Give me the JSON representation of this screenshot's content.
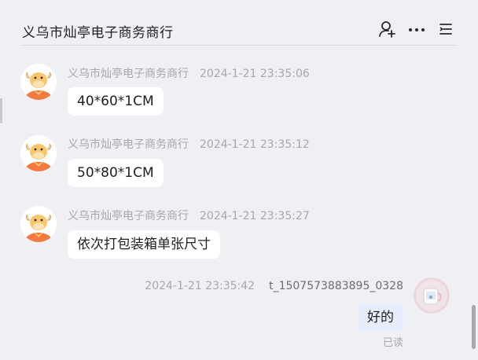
{
  "header": {
    "title": "义乌市灿亭电子商务商行",
    "icons": [
      "add-person-icon",
      "more-icon",
      "menu-list-icon"
    ]
  },
  "messages": [
    {
      "sender": "义乌市灿亭电子商务商行",
      "time": "2024-1-21 23:35:06",
      "text": "40*60*1CM"
    },
    {
      "sender": "义乌市灿亭电子商务商行",
      "time": "2024-1-21 23:35:12",
      "text": "50*80*1CM"
    },
    {
      "sender": "义乌市灿亭电子商务商行",
      "time": "2024-1-21 23:35:27",
      "text": "依次打包装箱单张尺寸"
    }
  ],
  "my_message": {
    "time": "2024-1-21 23:35:42",
    "sender": "t_1507573883895_0328",
    "text": "好的",
    "status": "已读"
  },
  "colors": {
    "background": "#eff0f4",
    "bubble": "#ffffff",
    "my_bubble": "#e6eefe",
    "avatar_accent": "#f47a42"
  }
}
